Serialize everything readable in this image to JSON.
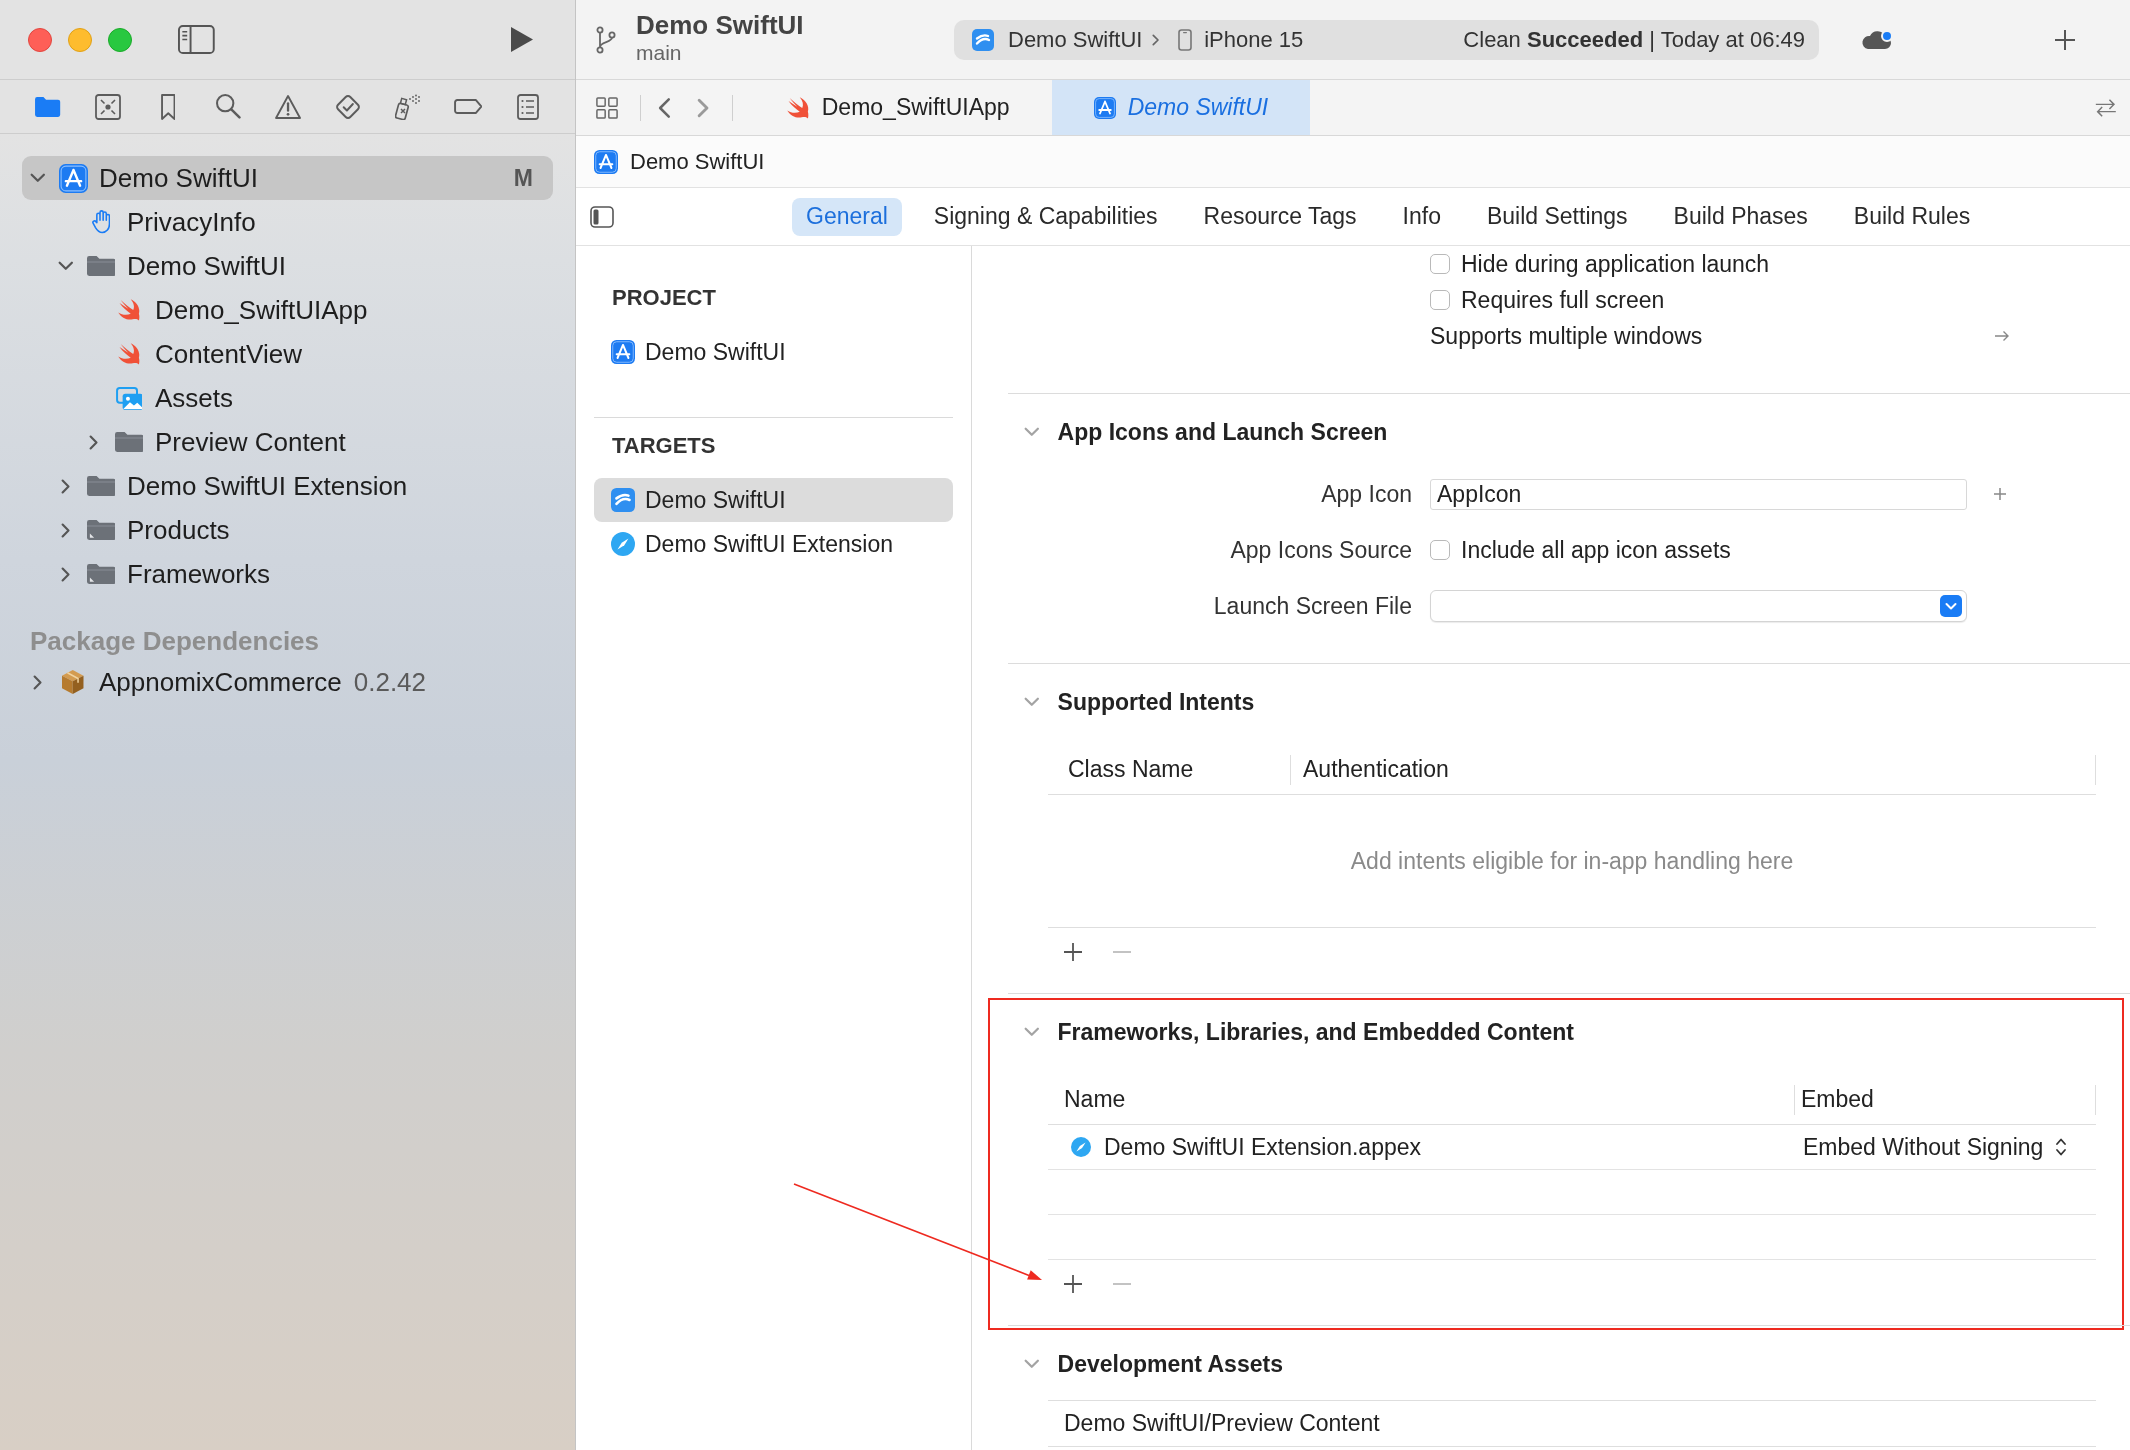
{
  "toolbar": {
    "project": "Demo SwiftUI",
    "branch": "main",
    "scheme": "Demo SwiftUI",
    "destination": "iPhone 15",
    "status": "Clean **Succeeded** | Today at 06:49"
  },
  "navigator": {
    "tabs": [
      {
        "selected": true
      },
      {
        "selected": false
      },
      {
        "selected": false
      },
      {
        "selected": false
      },
      {
        "selected": false
      },
      {
        "selected": false
      },
      {
        "selected": false
      },
      {
        "selected": false
      },
      {
        "selected": false
      }
    ]
  },
  "project_tree": [
    {
      "label": "Demo SwiftUI",
      "kind": "project",
      "badge": "M",
      "selected": true,
      "expanded": true,
      "children": [
        {
          "label": "PrivacyInfo",
          "kind": "privacy",
          "selected": false
        },
        {
          "label": "Demo SwiftUI",
          "kind": "folder",
          "selected": false,
          "expanded": true,
          "children": [
            {
              "label": "Demo_SwiftUIApp",
              "kind": "swift",
              "selected": false
            },
            {
              "label": "ContentView",
              "kind": "swift",
              "selected": false
            },
            {
              "label": "Assets",
              "kind": "assets",
              "selected": false
            },
            {
              "label": "Preview Content",
              "kind": "folder",
              "selected": false,
              "expanded": false
            }
          ]
        },
        {
          "label": "Demo SwiftUI Extension",
          "kind": "folder",
          "selected": false,
          "expanded": false
        },
        {
          "label": "Products",
          "kind": "group",
          "selected": false,
          "expanded": false
        },
        {
          "label": "Frameworks",
          "kind": "group",
          "selected": false,
          "expanded": false
        }
      ]
    }
  ],
  "package_dependencies": {
    "title": "Package Dependencies",
    "items": [
      {
        "label": "AppnomixCommerce",
        "version": "0.2.42",
        "kind": "package",
        "selected": false,
        "expanded": false
      }
    ]
  },
  "editor_tabs": [
    {
      "label": "Demo_SwiftUIApp",
      "kind": "swift",
      "selected": false,
      "preview": false
    },
    {
      "label": "Demo SwiftUI",
      "kind": "project",
      "selected": true,
      "preview": true
    }
  ],
  "breadcrumb": {
    "label": "Demo SwiftUI",
    "kind": "project"
  },
  "settings_tabs": [
    {
      "label": "General",
      "selected": true
    },
    {
      "label": "Signing & Capabilities",
      "selected": false
    },
    {
      "label": "Resource Tags",
      "selected": false
    },
    {
      "label": "Info",
      "selected": false
    },
    {
      "label": "Build Settings",
      "selected": false
    },
    {
      "label": "Build Phases",
      "selected": false
    },
    {
      "label": "Build Rules",
      "selected": false
    }
  ],
  "targets_pane": {
    "groups": [
      {
        "title": "PROJECT",
        "items": [
          {
            "label": "Demo SwiftUI",
            "kind": "project",
            "selected": false
          }
        ]
      },
      {
        "title": "TARGETS",
        "items": [
          {
            "label": "Demo SwiftUI",
            "kind": "app",
            "selected": true
          },
          {
            "label": "Demo SwiftUI Extension",
            "kind": "extension",
            "selected": false
          }
        ]
      }
    ]
  },
  "deployment_rows": [
    {
      "kind": "checkbox",
      "label": "Hide during application launch",
      "checked": false
    },
    {
      "kind": "checkbox",
      "label": "Requires full screen",
      "checked": false
    },
    {
      "kind": "link",
      "label": "Supports multiple windows"
    }
  ],
  "sections": [
    {
      "title": "App Icons and Launch Screen",
      "kind": "form",
      "expanded": true,
      "highlighted": false,
      "fields": [
        {
          "label": "App Icon",
          "kind": "text",
          "value": "AppIcon"
        },
        {
          "label": "App Icons Source",
          "kind": "checkbox",
          "option": "Include all app icon assets",
          "checked": false
        },
        {
          "label": "Launch Screen File",
          "kind": "popup"
        }
      ]
    },
    {
      "title": "Supported Intents",
      "kind": "table",
      "expanded": true,
      "highlighted": false,
      "columns": [
        "Class Name",
        "Authentication"
      ],
      "empty_message": "Add intents eligible for in-app handling here",
      "remove_button": {
        "disabled": true
      }
    },
    {
      "title": "Frameworks, Libraries, and Embedded Content",
      "kind": "table",
      "expanded": true,
      "highlighted": true,
      "columns": [
        "Name",
        "Embed"
      ],
      "rows": [
        {
          "kind": "extension",
          "name": "Demo SwiftUI Extension.appex",
          "embed": "Embed Without Signing"
        }
      ],
      "remove_button": {
        "disabled": true
      }
    },
    {
      "title": "Development Assets",
      "kind": "list",
      "expanded": true,
      "highlighted": false,
      "rows": [
        "Demo SwiftUI/Preview Content"
      ]
    }
  ]
}
